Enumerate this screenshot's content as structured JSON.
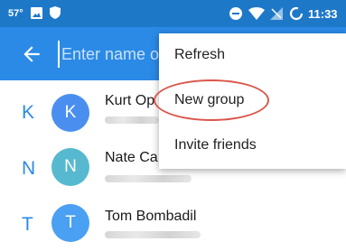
{
  "status_bar": {
    "temperature": "57°",
    "time": "11:33",
    "icons": [
      "image-icon",
      "shield-icon",
      "minus-circle-icon",
      "wifi-icon",
      "no-signal-icon",
      "battery-charging-icon"
    ]
  },
  "app_bar": {
    "back_icon": "arrow-left-icon",
    "search_placeholder": "Enter name or number"
  },
  "contacts": [
    {
      "section": "K",
      "avatar_letter": "K",
      "name": "Kurt Op",
      "avatar_color": "#4a8ff0"
    },
    {
      "section": "N",
      "avatar_letter": "N",
      "name": "Nate Ca",
      "avatar_color": "#56b9cf"
    },
    {
      "section": "T",
      "avatar_letter": "T",
      "name": "Tom Bombadil",
      "avatar_color": "#4aa0f2"
    }
  ],
  "menu": {
    "items": [
      {
        "label": "Refresh"
      },
      {
        "label": "New group"
      },
      {
        "label": "Invite friends"
      }
    ],
    "highlight_color": "#d9574a"
  },
  "colors": {
    "status_bar": "#1e78c8",
    "app_bar": "#2b8ae6",
    "accent": "#2b8ae6"
  }
}
